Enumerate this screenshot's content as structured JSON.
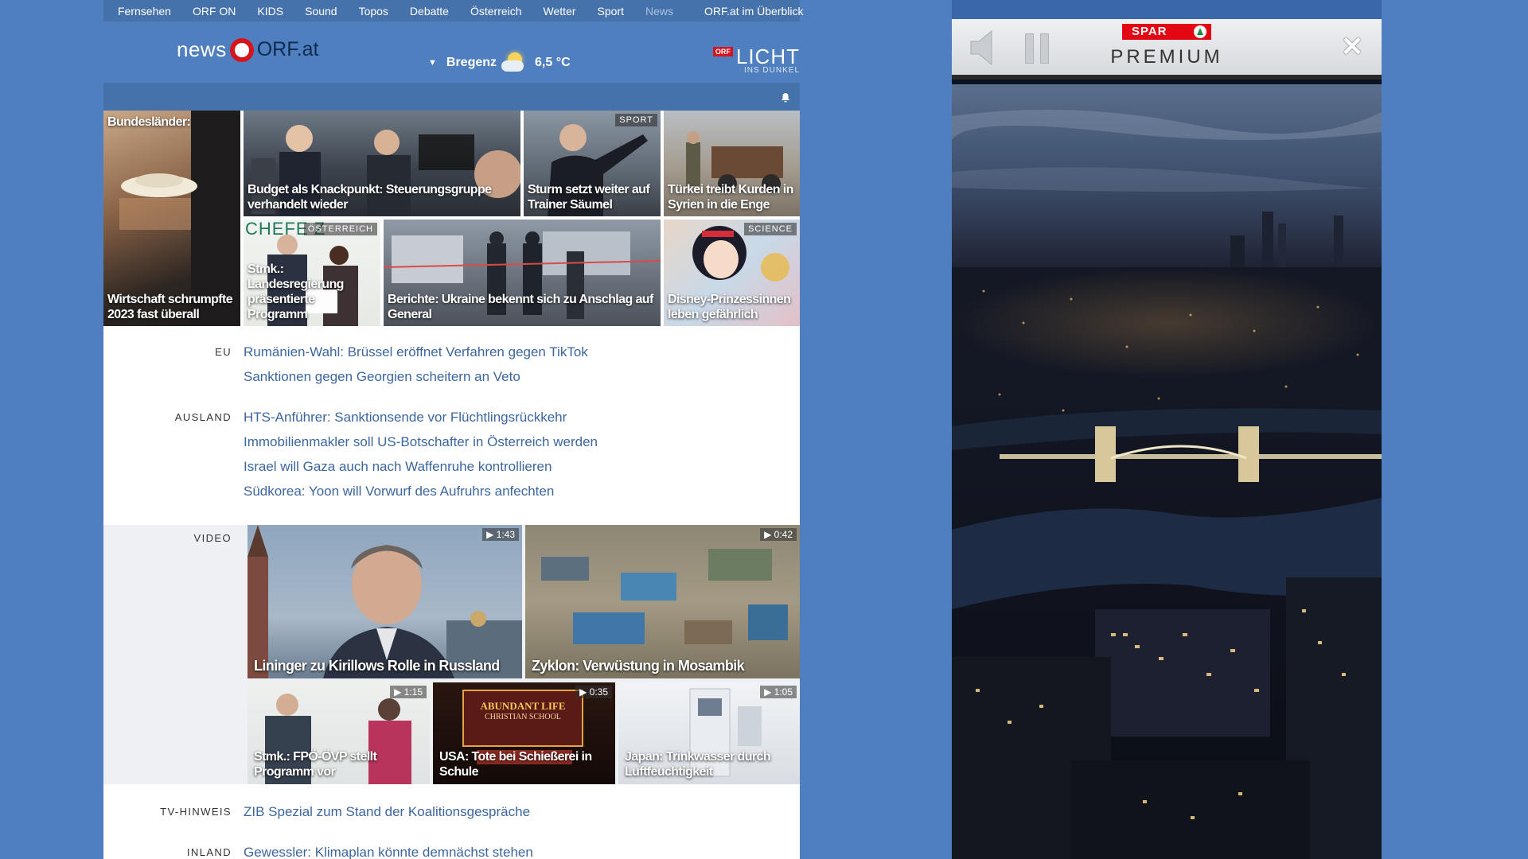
{
  "nav": {
    "items": [
      "Fernsehen",
      "ORF ON",
      "KIDS",
      "Sound",
      "Topos",
      "Debatte",
      "Österreich",
      "Wetter",
      "Sport",
      "News"
    ],
    "active": "News",
    "overview": "ORF.at im Überblick"
  },
  "logo": {
    "news": "news",
    "orf": "ORF.at"
  },
  "weather": {
    "city": "Bregenz",
    "temp": "6,5 °C"
  },
  "licht": {
    "badge": "ORF",
    "big": "LICHT",
    "small": "INS DUNKEL"
  },
  "teasers": {
    "bundeslaender_label": "Bundesländer:",
    "bundeslaender": "Wirtschaft schrumpfte 2023 fast überall",
    "budget": "Budget als Knackpunkt: Steuerungsgruppe verhandelt wieder",
    "sturm_tag": "SPORT",
    "sturm": "Sturm setzt weiter auf Trainer Säumel",
    "tuerkei": "Türkei treibt Kurden in Syrien in die Enge",
    "stmk_tag": "ÖSTERREICH",
    "stmk_bg_text": "CHEFE Z",
    "stmk": "Stmk.: Landesregierung präsentierte Programm",
    "berichte": "Berichte: Ukraine bekennt sich zu Anschlag auf General",
    "disney_tag": "SCIENCE",
    "disney": "Disney-Prinzessinnen leben gefährlich"
  },
  "sections": {
    "eu": {
      "label": "EU",
      "links": [
        "Rumänien-Wahl: Brüssel eröffnet Verfahren gegen TikTok",
        "Sanktionen gegen Georgien scheitern an Veto"
      ]
    },
    "ausland": {
      "label": "AUSLAND",
      "links": [
        "HTS-Anführer: Sanktionsende vor Flüchtlingsrückkehr",
        "Immobilienmakler soll US-Botschafter in Österreich werden",
        "Israel will Gaza auch nach Waffenruhe kontrollieren",
        "Südkorea: Yoon will Vorwurf des Aufruhrs anfechten"
      ]
    },
    "video": {
      "label": "VIDEO"
    },
    "tv": {
      "label": "TV-HINWEIS",
      "links": [
        "ZIB Spezial zum Stand der Koalitionsgespräche"
      ]
    },
    "inland": {
      "label": "INLAND",
      "links": [
        "Gewessler: Klimaplan könnte demnächst stehen"
      ]
    }
  },
  "videos": [
    {
      "title": "Lininger zu Kirillows Rolle in Russland",
      "duration": "1:43"
    },
    {
      "title": "Zyklon: Verwüstung in Mosambik",
      "duration": "0:42"
    },
    {
      "title": "Stmk.: FPÖ-ÖVP stellt Programm vor",
      "duration": "1:15"
    },
    {
      "title": "USA: Tote bei Schießerei in Schule",
      "duration": "0:35"
    },
    {
      "title": "Japan: Trinkwasser durch Luftfeuchtigkeit",
      "duration": "1:05"
    }
  ],
  "school_sign": {
    "line1": "ABUNDANT LIFE",
    "line2": "CHRISTIAN SCHOOL"
  },
  "ad": {
    "brand": "SPAR",
    "title": "PREMIUM"
  }
}
